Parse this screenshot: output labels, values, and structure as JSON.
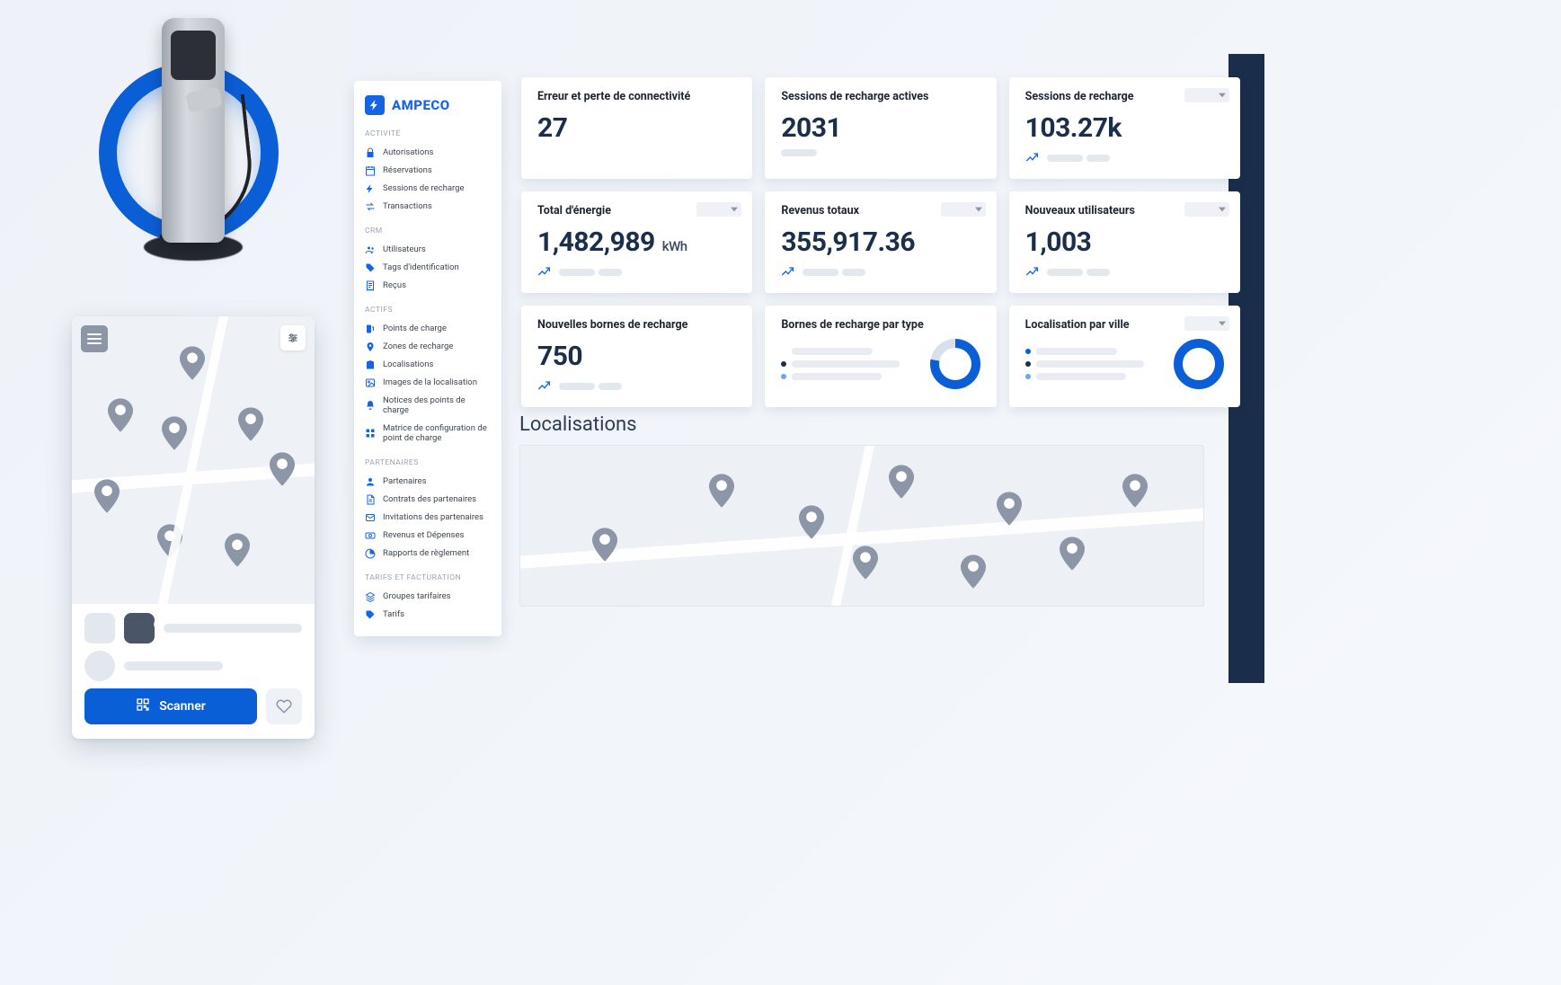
{
  "brand": {
    "name": "AMPECO"
  },
  "sidebar": {
    "groups": [
      {
        "heading": "ACTIVITÉ",
        "items": [
          {
            "icon": "lock-icon",
            "label": "Autorisations"
          },
          {
            "icon": "calendar-icon",
            "label": "Réservations"
          },
          {
            "icon": "bolt-icon",
            "label": "Sessions de recharge"
          },
          {
            "icon": "swap-icon",
            "label": "Transactions"
          }
        ]
      },
      {
        "heading": "CRM",
        "items": [
          {
            "icon": "users-icon",
            "label": "Utilisateurs"
          },
          {
            "icon": "tag-icon",
            "label": "Tags d'identification"
          },
          {
            "icon": "receipt-icon",
            "label": "Reçus"
          }
        ]
      },
      {
        "heading": "ACTIFS",
        "items": [
          {
            "icon": "station-icon",
            "label": "Points de charge"
          },
          {
            "icon": "pin-icon",
            "label": "Zones de recharge"
          },
          {
            "icon": "building-icon",
            "label": "Localisations"
          },
          {
            "icon": "image-icon",
            "label": "Images de la localisation"
          },
          {
            "icon": "bell-icon",
            "label": "Notices des points de charge"
          },
          {
            "icon": "grid-icon",
            "label": "Matrice de configuration de point de charge"
          }
        ]
      },
      {
        "heading": "PARTENAIRES",
        "items": [
          {
            "icon": "user-icon",
            "label": "Partenaires"
          },
          {
            "icon": "contract-icon",
            "label": "Contrats des partenaires"
          },
          {
            "icon": "mail-icon",
            "label": "Invitations des partenaires"
          },
          {
            "icon": "money-icon",
            "label": "Revenus et Dépenses"
          },
          {
            "icon": "pie-icon",
            "label": "Rapports de règlement"
          }
        ]
      },
      {
        "heading": "TARIFS ET FACTURATION",
        "items": [
          {
            "icon": "layers-icon",
            "label": "Groupes tarifaires"
          },
          {
            "icon": "pricetag-icon",
            "label": "Tarifs"
          }
        ]
      }
    ]
  },
  "cards": {
    "errors": {
      "title": "Erreur et perte de connectivité",
      "value": "27"
    },
    "sessions": {
      "title": "Sessions de recharge actives",
      "value": "2031"
    },
    "recharge": {
      "title": "Sessions de recharge",
      "value": "103.27k"
    },
    "energy": {
      "title": "Total d'énergie",
      "value": "1,482,989",
      "unit": "kWh"
    },
    "revenue": {
      "title": "Revenus totaux",
      "value": "355,917.36"
    },
    "users": {
      "title": "Nouveaux utilisateurs",
      "value": "1,003"
    },
    "stations": {
      "title": "Nouvelles bornes de recharge",
      "value": "750"
    },
    "byType": {
      "title": "Bornes de recharge par type"
    },
    "byCity": {
      "title": "Localisation par ville"
    }
  },
  "loc": {
    "title": "Localisations"
  },
  "mobile": {
    "scan_label": "Scanner"
  },
  "colors": {
    "dotA": "#0b5fd6",
    "dotB": "#1b2e4b",
    "dotC": "#6fa6f2"
  }
}
